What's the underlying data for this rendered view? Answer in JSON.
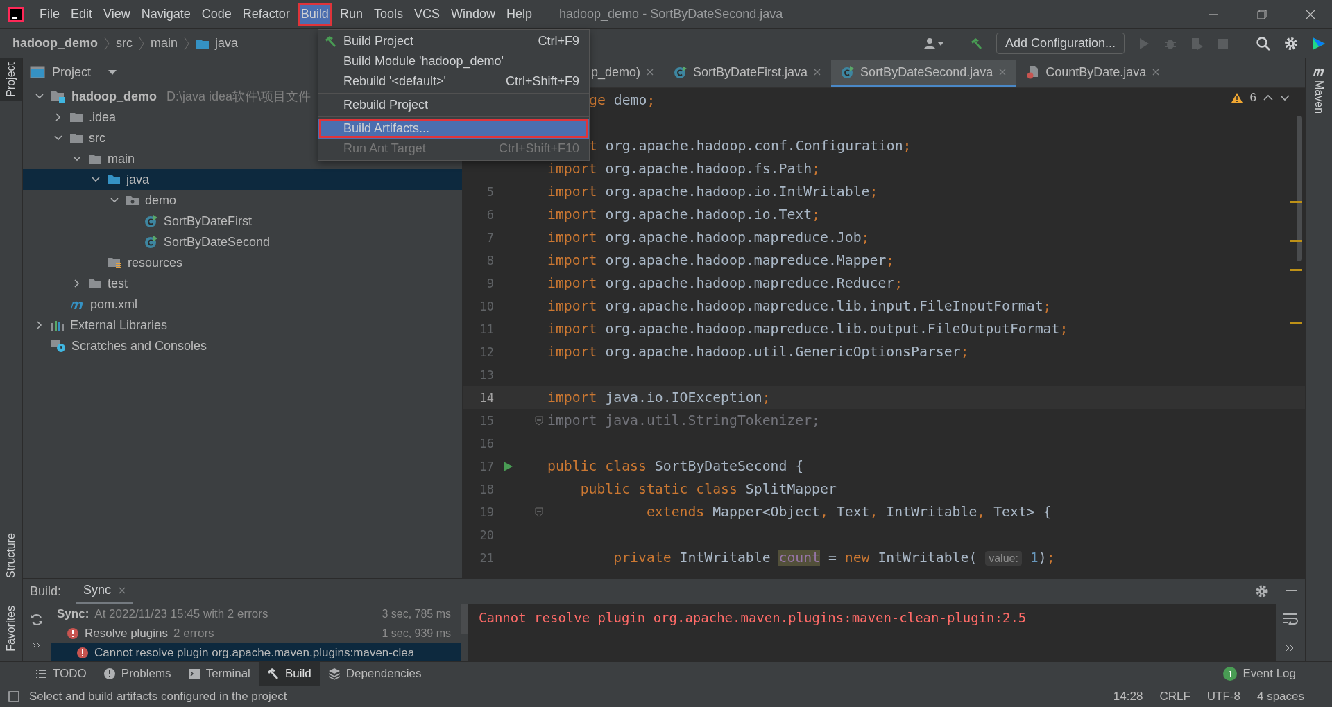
{
  "window": {
    "title": "hadoop_demo - SortByDateSecond.java"
  },
  "menu_bar": {
    "items": [
      {
        "label": "File",
        "selected": false
      },
      {
        "label": "Edit",
        "selected": false
      },
      {
        "label": "View",
        "selected": false
      },
      {
        "label": "Navigate",
        "selected": false
      },
      {
        "label": "Code",
        "selected": false
      },
      {
        "label": "Refactor",
        "selected": false
      },
      {
        "label": "Build",
        "selected": true
      },
      {
        "label": "Run",
        "selected": false
      },
      {
        "label": "Tools",
        "selected": false
      },
      {
        "label": "VCS",
        "selected": false
      },
      {
        "label": "Window",
        "selected": false
      },
      {
        "label": "Help",
        "selected": false
      }
    ]
  },
  "navigation_bar": {
    "breadcrumbs": [
      {
        "label": "hadoop_demo",
        "kind": "project"
      },
      {
        "label": "src",
        "kind": "dir"
      },
      {
        "label": "main",
        "kind": "dir"
      },
      {
        "label": "java",
        "kind": "source"
      }
    ],
    "run_configuration": "Add Configuration..."
  },
  "build_menu": {
    "items": [
      {
        "kind": "item",
        "label": "Build Project",
        "shortcut": "Ctrl+F9",
        "selected": false,
        "disabled": false
      },
      {
        "kind": "item",
        "label": "Build Module 'hadoop_demo'",
        "selected": false,
        "disabled": false
      },
      {
        "kind": "item",
        "label": "Rebuild '<default>'",
        "shortcut": "Ctrl+Shift+F9",
        "selected": false,
        "disabled": false
      },
      {
        "kind": "separator"
      },
      {
        "kind": "item",
        "label": "Rebuild Project",
        "selected": false,
        "disabled": false
      },
      {
        "kind": "separator"
      },
      {
        "kind": "item",
        "label": "Build Artifacts...",
        "selected": true,
        "disabled": false
      },
      {
        "kind": "item",
        "label": "Run Ant Target",
        "shortcut": "Ctrl+Shift+F10",
        "selected": false,
        "disabled": true
      }
    ]
  },
  "left_stripe": [
    {
      "label": "Project",
      "selected": true
    },
    {
      "label": "Structure",
      "selected": false
    },
    {
      "label": "Favorites",
      "selected": false
    }
  ],
  "right_stripe": [
    {
      "label": "Maven",
      "selected": false
    }
  ],
  "project_panel": {
    "title": "Project",
    "tree": [
      {
        "label": "hadoop_demo",
        "kind": "module",
        "note": "D:\\java idea软件\\项目文件",
        "expanded": true,
        "selected": false,
        "children": [
          {
            "label": ".idea",
            "kind": "folder",
            "expanded": false,
            "selected": false
          },
          {
            "label": "src",
            "kind": "folder",
            "expanded": true,
            "selected": false,
            "children": [
              {
                "label": "main",
                "kind": "folder",
                "expanded": true,
                "selected": false,
                "children": [
                  {
                    "label": "java",
                    "kind": "source",
                    "expanded": true,
                    "selected": true,
                    "children": [
                      {
                        "label": "demo",
                        "kind": "package",
                        "expanded": true,
                        "selected": false,
                        "children": [
                          {
                            "label": "SortByDateFirst",
                            "kind": "class",
                            "selected": false
                          },
                          {
                            "label": "SortByDateSecond",
                            "kind": "class",
                            "selected": false
                          }
                        ]
                      }
                    ]
                  },
                  {
                    "label": "resources",
                    "kind": "resources",
                    "selected": false
                  }
                ]
              },
              {
                "label": "test",
                "kind": "folder",
                "expanded": false,
                "selected": false
              }
            ]
          },
          {
            "label": "pom.xml",
            "kind": "maven",
            "selected": false
          }
        ]
      },
      {
        "label": "External Libraries",
        "kind": "libraries",
        "expanded": false,
        "selected": false
      },
      {
        "label": "Scratches and Consoles",
        "kind": "scratches",
        "selected": false
      }
    ]
  },
  "editor": {
    "tabs": [
      {
        "label": "p_demo)",
        "cut": true,
        "selected": false
      },
      {
        "label": "SortByDateFirst.java",
        "kind": "class",
        "selected": false
      },
      {
        "label": "SortByDateSecond.java",
        "kind": "class",
        "selected": true
      },
      {
        "label": "CountByDate.java",
        "kind": "file",
        "selected": false
      }
    ],
    "warning_count": "6",
    "lines": [
      {
        "cut": true,
        "tokens": [
          {
            "kind": "k",
            "text": "ge"
          },
          {
            "kind": "t",
            "text": " demo"
          },
          {
            "kind": "p",
            "text": ";"
          }
        ]
      },
      {
        "cut": true
      },
      {
        "cut": true,
        "tokens": [
          {
            "kind": "k",
            "text": "t"
          },
          {
            "kind": "t",
            "text": " org.apache.hadoop.conf.Configuration"
          },
          {
            "kind": "p",
            "text": ";"
          }
        ]
      },
      {
        "tokens": [
          {
            "kind": "k",
            "text": "import"
          },
          {
            "kind": "t",
            "text": " org.apache.hadoop.fs.Path"
          },
          {
            "kind": "p",
            "text": ";"
          }
        ]
      },
      {
        "number": "5",
        "tokens": [
          {
            "kind": "k",
            "text": "import"
          },
          {
            "kind": "t",
            "text": " org.apache.hadoop.io.IntWritable"
          },
          {
            "kind": "p",
            "text": ";"
          }
        ]
      },
      {
        "number": "6",
        "tokens": [
          {
            "kind": "k",
            "text": "import"
          },
          {
            "kind": "t",
            "text": " org.apache.hadoop.io.Text"
          },
          {
            "kind": "p",
            "text": ";"
          }
        ]
      },
      {
        "number": "7",
        "tokens": [
          {
            "kind": "k",
            "text": "import"
          },
          {
            "kind": "t",
            "text": " org.apache.hadoop.mapreduce.Job"
          },
          {
            "kind": "p",
            "text": ";"
          }
        ]
      },
      {
        "number": "8",
        "tokens": [
          {
            "kind": "k",
            "text": "import"
          },
          {
            "kind": "t",
            "text": " org.apache.hadoop.mapreduce.Mapper"
          },
          {
            "kind": "p",
            "text": ";"
          }
        ]
      },
      {
        "number": "9",
        "tokens": [
          {
            "kind": "k",
            "text": "import"
          },
          {
            "kind": "t",
            "text": " org.apache.hadoop.mapreduce.Reducer"
          },
          {
            "kind": "p",
            "text": ";"
          }
        ]
      },
      {
        "number": "10",
        "tokens": [
          {
            "kind": "k",
            "text": "import"
          },
          {
            "kind": "t",
            "text": " org.apache.hadoop.mapreduce.lib.input.FileInputFormat"
          },
          {
            "kind": "p",
            "text": ";"
          }
        ]
      },
      {
        "number": "11",
        "tokens": [
          {
            "kind": "k",
            "text": "import"
          },
          {
            "kind": "t",
            "text": " org.apache.hadoop.mapreduce.lib.output.FileOutputFormat"
          },
          {
            "kind": "p",
            "text": ";"
          }
        ]
      },
      {
        "number": "12",
        "tokens": [
          {
            "kind": "k",
            "text": "import"
          },
          {
            "kind": "t",
            "text": " org.apache.hadoop.util.GenericOptionsParser"
          },
          {
            "kind": "p",
            "text": ";"
          }
        ]
      },
      {
        "number": "13"
      },
      {
        "number": "14",
        "current": true,
        "tokens": [
          {
            "kind": "k",
            "text": "import"
          },
          {
            "kind": "t",
            "text": " java.io.IOException"
          },
          {
            "kind": "p",
            "text": ";"
          }
        ]
      },
      {
        "number": "15",
        "kind": "fold",
        "tokens": [
          {
            "kind": "u",
            "text": "import java.util.StringTokenizer;"
          }
        ]
      },
      {
        "number": "16"
      },
      {
        "number": "17",
        "kind": "run",
        "tokens": [
          {
            "kind": "k",
            "text": "public class"
          },
          {
            "kind": "t",
            "text": " SortByDateSecond {"
          }
        ]
      },
      {
        "number": "18",
        "tokens": [
          {
            "kind": "k",
            "text": "    public static class"
          },
          {
            "kind": "t",
            "text": " SplitMapper"
          }
        ]
      },
      {
        "number": "19",
        "kind": "fold",
        "tokens": [
          {
            "kind": "k",
            "text": "            extends"
          },
          {
            "kind": "t",
            "text": " Mapper<Object"
          },
          {
            "kind": "p",
            "text": ","
          },
          {
            "kind": "t",
            "text": " Text"
          },
          {
            "kind": "p",
            "text": ","
          },
          {
            "kind": "t",
            "text": " IntWritable"
          },
          {
            "kind": "p",
            "text": ","
          },
          {
            "kind": "t",
            "text": " Text> {"
          }
        ]
      },
      {
        "number": "20"
      },
      {
        "number": "21",
        "tokens": [
          {
            "kind": "k",
            "text": "        private"
          },
          {
            "kind": "t",
            "text": " IntWritable "
          },
          {
            "kind": "f",
            "text": "count"
          },
          {
            "kind": "t",
            "text": " = "
          },
          {
            "kind": "k",
            "text": "new"
          },
          {
            "kind": "t",
            "text": " IntWritable( "
          },
          {
            "kind": "h",
            "text": "value:"
          },
          {
            "kind": "n",
            "text": " 1"
          },
          {
            "kind": "t",
            "text": ")"
          },
          {
            "kind": "p",
            "text": ";"
          }
        ]
      }
    ]
  },
  "build_panel": {
    "label": "Build:",
    "tabs": [
      {
        "label": "Sync",
        "selected": true
      }
    ],
    "tree": [
      {
        "label": "Sync:",
        "detail": "At 2022/11/23 15:45 with 2 errors",
        "time": "3 sec, 785 ms",
        "selected": false,
        "children": [
          {
            "label": "Resolve plugins",
            "detail": "2 errors",
            "time": "1 sec, 939 ms",
            "kind": "error",
            "selected": false,
            "children": [
              {
                "label": "Cannot resolve plugin org.apache.maven.plugins:maven-clea",
                "kind": "error",
                "selected": true
              }
            ]
          }
        ]
      }
    ],
    "console": [
      "Cannot resolve plugin org.apache.maven.plugins:maven-clean-plugin:2.5"
    ]
  },
  "tool_window_bar": {
    "items": [
      {
        "label": "TODO",
        "selected": false
      },
      {
        "label": "Problems",
        "selected": false
      },
      {
        "label": "Terminal",
        "selected": false
      },
      {
        "label": "Build",
        "selected": true
      },
      {
        "label": "Dependencies",
        "selected": false
      }
    ],
    "event_log": {
      "label": "Event Log",
      "count": "1"
    }
  },
  "status_bar": {
    "message": "Select and build artifacts configured in the project",
    "items": [
      "14:28",
      "CRLF",
      "UTF-8",
      "4 spaces"
    ]
  }
}
